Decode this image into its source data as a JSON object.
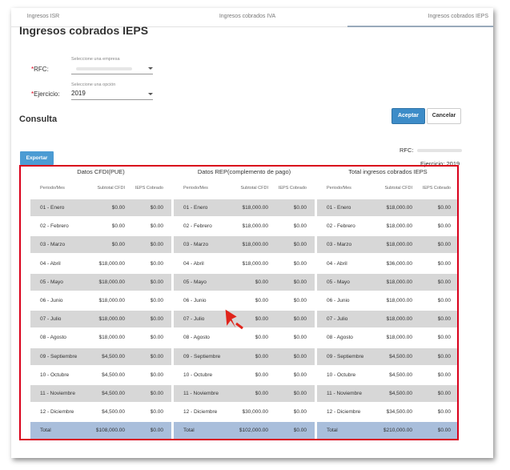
{
  "tabs": [
    {
      "label": "Ingresos ISR"
    },
    {
      "label": "Ingresos cobrados IVA"
    },
    {
      "label": "Ingresos cobrados IEPS"
    }
  ],
  "page": {
    "title": "Ingresos cobrados IEPS",
    "required_mark": "*"
  },
  "form": {
    "rfc": {
      "label": "RFC:",
      "hint": "Seleccione una empresa",
      "value": ""
    },
    "ejercicio": {
      "label": "Ejercicio:",
      "hint": "Seleccione una opción",
      "value": "2019"
    }
  },
  "buttons": {
    "aceptar": "Aceptar",
    "cancelar": "Cancelar",
    "exportar": "Exportar"
  },
  "consulta": {
    "title": "Consulta",
    "rfc_label": "RFC:",
    "ejercicio_label": "Ejercicio: 2019"
  },
  "colors": {
    "highlight": "#d9001b",
    "primary": "#3d8cc8",
    "row_alt": "#d7d7d7",
    "total_row": "#a9bedb"
  },
  "table": {
    "groups": [
      {
        "title": "Datos CFDI(PUE)"
      },
      {
        "title": "Datos REP(complemento de pago)"
      },
      {
        "title": "Total ingresos cobrados IEPS"
      }
    ],
    "headers": [
      "Periodo/Mes",
      "Subtotal CFDI",
      "IEPS Cobrado"
    ],
    "rows": [
      {
        "cells": [
          [
            "01 - Enero",
            "$0.00",
            "$0.00"
          ],
          [
            "01 - Enero",
            "$18,000.00",
            "$0.00"
          ],
          [
            "01 - Enero",
            "$18,000.00",
            "$0.00"
          ]
        ]
      },
      {
        "cells": [
          [
            "02 - Febrero",
            "$0.00",
            "$0.00"
          ],
          [
            "02 - Febrero",
            "$18,000.00",
            "$0.00"
          ],
          [
            "02 - Febrero",
            "$18,000.00",
            "$0.00"
          ]
        ]
      },
      {
        "cells": [
          [
            "03 - Marzo",
            "$0.00",
            "$0.00"
          ],
          [
            "03 - Marzo",
            "$18,000.00",
            "$0.00"
          ],
          [
            "03 - Marzo",
            "$18,000.00",
            "$0.00"
          ]
        ]
      },
      {
        "cells": [
          [
            "04 - Abril",
            "$18,000.00",
            "$0.00"
          ],
          [
            "04 - Abril",
            "$18,000.00",
            "$0.00"
          ],
          [
            "04 - Abril",
            "$36,000.00",
            "$0.00"
          ]
        ]
      },
      {
        "cells": [
          [
            "05 - Mayo",
            "$18,000.00",
            "$0.00"
          ],
          [
            "05 - Mayo",
            "$0.00",
            "$0.00"
          ],
          [
            "05 - Mayo",
            "$18,000.00",
            "$0.00"
          ]
        ]
      },
      {
        "cells": [
          [
            "06 - Junio",
            "$18,000.00",
            "$0.00"
          ],
          [
            "06 - Junio",
            "$0.00",
            "$0.00"
          ],
          [
            "06 - Junio",
            "$18,000.00",
            "$0.00"
          ]
        ]
      },
      {
        "cells": [
          [
            "07 - Julio",
            "$18,000.00",
            "$0.00"
          ],
          [
            "07 - Julio",
            "$0.00",
            "$0.00"
          ],
          [
            "07 - Julio",
            "$18,000.00",
            "$0.00"
          ]
        ]
      },
      {
        "cells": [
          [
            "08 - Agosto",
            "$18,000.00",
            "$0.00"
          ],
          [
            "08 - Agosto",
            "$0.00",
            "$0.00"
          ],
          [
            "08 - Agosto",
            "$18,000.00",
            "$0.00"
          ]
        ]
      },
      {
        "cells": [
          [
            "09 - Septiembre",
            "$4,500.00",
            "$0.00"
          ],
          [
            "09 - Septiembre",
            "$0.00",
            "$0.00"
          ],
          [
            "09 - Septiembre",
            "$4,500.00",
            "$0.00"
          ]
        ]
      },
      {
        "cells": [
          [
            "10 - Octubre",
            "$4,500.00",
            "$0.00"
          ],
          [
            "10 - Octubre",
            "$0.00",
            "$0.00"
          ],
          [
            "10 - Octubre",
            "$4,500.00",
            "$0.00"
          ]
        ]
      },
      {
        "cells": [
          [
            "11 - Noviembre",
            "$4,500.00",
            "$0.00"
          ],
          [
            "11 - Noviembre",
            "$0.00",
            "$0.00"
          ],
          [
            "11 - Noviembre",
            "$4,500.00",
            "$0.00"
          ]
        ]
      },
      {
        "cells": [
          [
            "12 - Diciembre",
            "$4,500.00",
            "$0.00"
          ],
          [
            "12 - Diciembre",
            "$30,000.00",
            "$0.00"
          ],
          [
            "12 - Diciembre",
            "$34,500.00",
            "$0.00"
          ]
        ]
      },
      {
        "total": true,
        "cells": [
          [
            "Total",
            "$108,000.00",
            "$0.00"
          ],
          [
            "Total",
            "$102,000.00",
            "$0.00"
          ],
          [
            "Total",
            "$210,000.00",
            "$0.00"
          ]
        ]
      }
    ]
  }
}
